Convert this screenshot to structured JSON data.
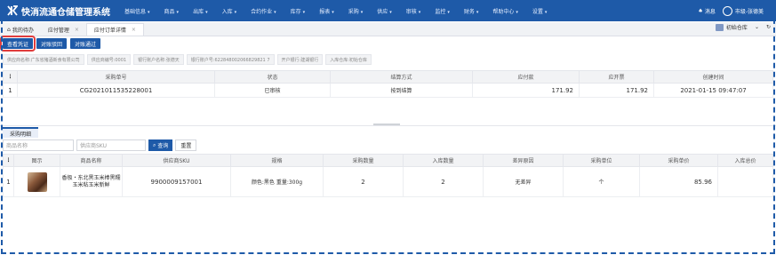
{
  "app": {
    "title": "快消流通仓储管理系统"
  },
  "nav": {
    "menus": [
      "基础信息",
      "商品",
      "出库",
      "入库",
      "合约作业",
      "库存",
      "报表",
      "采购",
      "供应",
      "审核",
      "监控",
      "财务",
      "帮助中心",
      "设置"
    ],
    "message": "消息",
    "user": "市级-张德美"
  },
  "tabs": [
    {
      "label": "我的待办"
    },
    {
      "label": "应付管理"
    },
    {
      "label": "应付订单详情"
    }
  ],
  "tabbar_right": {
    "warehouse": "初始仓库"
  },
  "actions": {
    "view_voucher": "查看凭证",
    "reject": "对账驳回",
    "approve": "对账通过"
  },
  "info_chips": [
    "供应商名称:广东省猪酒新食有限公司",
    "供应商编号:0001",
    "银行账户名称:张德天",
    "银行账户号:622848002066829821 7",
    "开户银行:建湖银行",
    "入库仓库:初始仓库"
  ],
  "order_table": {
    "headers": [
      "",
      "采购单号",
      "状态",
      "结算方式",
      "应付款",
      "应开票",
      "创建时间"
    ],
    "rows": [
      {
        "index": "1",
        "order_no": "CG2021011535228001",
        "status": "已审核",
        "settlement": "按到结算",
        "payable": "171.92",
        "invoice": "171.92",
        "created": "2021-01-15 09:47:07"
      }
    ]
  },
  "detail": {
    "section_tab": "采购明细",
    "filter_name_placeholder": "商品名称",
    "filter_sku_placeholder": "供应商SKU",
    "search": "查询",
    "reset": "重置"
  },
  "detail_table": {
    "headers": [
      "",
      "图示",
      "商品名称",
      "供应商SKU",
      "规格",
      "采购数量",
      "入库数量",
      "差异原因",
      "采购单位",
      "采购单价",
      "入库总价"
    ],
    "rows": [
      {
        "index": "1",
        "name": "香极・东北黑玉米棒黑糯玉米粘玉米新鲜",
        "sku": "9900009157001",
        "spec": "颜色:黑色 重量:300g",
        "qty": "2",
        "in_qty": "2",
        "reason": "无差异",
        "unit": "个",
        "price": "85.96",
        "total": ""
      }
    ]
  },
  "colors": {
    "brand": "#1e5aa8",
    "highlight": "#e03d3d"
  }
}
